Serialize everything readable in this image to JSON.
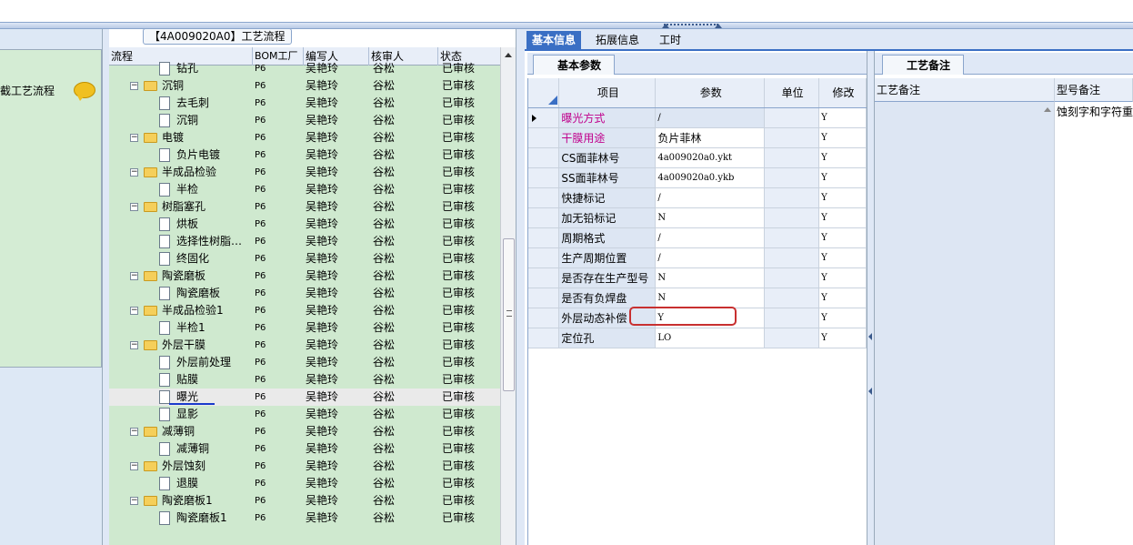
{
  "left_panel": {
    "title": "截工艺流程"
  },
  "tab_chip": {
    "label": "【4A009020A0】工艺流程"
  },
  "tree": {
    "headers": {
      "flow": "流程",
      "bom": "BOM工厂",
      "writer": "编写人",
      "reviewer": "核审人",
      "status": "状态"
    },
    "rows": [
      {
        "label": "钻孔",
        "type": "doc",
        "bom": "P6",
        "writer": "吴艳玲",
        "reviewer": "谷松",
        "status": "已审核"
      },
      {
        "label": "沉铜",
        "type": "folder",
        "bom": "P6",
        "writer": "吴艳玲",
        "reviewer": "谷松",
        "status": "已审核"
      },
      {
        "label": "去毛刺",
        "type": "doc",
        "bom": "P6",
        "writer": "吴艳玲",
        "reviewer": "谷松",
        "status": "已审核"
      },
      {
        "label": "沉铜",
        "type": "doc",
        "bom": "P6",
        "writer": "吴艳玲",
        "reviewer": "谷松",
        "status": "已审核"
      },
      {
        "label": "电镀",
        "type": "folder",
        "bom": "P6",
        "writer": "吴艳玲",
        "reviewer": "谷松",
        "status": "已审核"
      },
      {
        "label": "负片电镀",
        "type": "doc",
        "bom": "P6",
        "writer": "吴艳玲",
        "reviewer": "谷松",
        "status": "已审核"
      },
      {
        "label": "半成品检验",
        "type": "folder",
        "bom": "P6",
        "writer": "吴艳玲",
        "reviewer": "谷松",
        "status": "已审核"
      },
      {
        "label": "半检",
        "type": "doc",
        "bom": "P6",
        "writer": "吴艳玲",
        "reviewer": "谷松",
        "status": "已审核"
      },
      {
        "label": "树脂塞孔",
        "type": "folder",
        "bom": "P6",
        "writer": "吴艳玲",
        "reviewer": "谷松",
        "status": "已审核"
      },
      {
        "label": "烘板",
        "type": "doc",
        "bom": "P6",
        "writer": "吴艳玲",
        "reviewer": "谷松",
        "status": "已审核"
      },
      {
        "label": "选择性树脂…",
        "type": "doc",
        "bom": "P6",
        "writer": "吴艳玲",
        "reviewer": "谷松",
        "status": "已审核"
      },
      {
        "label": "终固化",
        "type": "doc",
        "bom": "P6",
        "writer": "吴艳玲",
        "reviewer": "谷松",
        "status": "已审核"
      },
      {
        "label": "陶瓷磨板",
        "type": "folder",
        "bom": "P6",
        "writer": "吴艳玲",
        "reviewer": "谷松",
        "status": "已审核"
      },
      {
        "label": "陶瓷磨板",
        "type": "doc",
        "bom": "P6",
        "writer": "吴艳玲",
        "reviewer": "谷松",
        "status": "已审核"
      },
      {
        "label": "半成品检验1",
        "type": "folder",
        "bom": "P6",
        "writer": "吴艳玲",
        "reviewer": "谷松",
        "status": "已审核"
      },
      {
        "label": "半检1",
        "type": "doc",
        "bom": "P6",
        "writer": "吴艳玲",
        "reviewer": "谷松",
        "status": "已审核"
      },
      {
        "label": "外层干膜",
        "type": "folder",
        "bom": "P6",
        "writer": "吴艳玲",
        "reviewer": "谷松",
        "status": "已审核"
      },
      {
        "label": "外层前处理",
        "type": "doc",
        "bom": "P6",
        "writer": "吴艳玲",
        "reviewer": "谷松",
        "status": "已审核"
      },
      {
        "label": "贴膜",
        "type": "doc",
        "bom": "P6",
        "writer": "吴艳玲",
        "reviewer": "谷松",
        "status": "已审核"
      },
      {
        "label": "曝光",
        "type": "doc",
        "bom": "P6",
        "writer": "吴艳玲",
        "reviewer": "谷松",
        "status": "已审核",
        "selected": true
      },
      {
        "label": "显影",
        "type": "doc",
        "bom": "P6",
        "writer": "吴艳玲",
        "reviewer": "谷松",
        "status": "已审核"
      },
      {
        "label": "减薄铜",
        "type": "folder",
        "bom": "P6",
        "writer": "吴艳玲",
        "reviewer": "谷松",
        "status": "已审核"
      },
      {
        "label": "减薄铜",
        "type": "doc",
        "bom": "P6",
        "writer": "吴艳玲",
        "reviewer": "谷松",
        "status": "已审核"
      },
      {
        "label": "外层蚀刻",
        "type": "folder",
        "bom": "P6",
        "writer": "吴艳玲",
        "reviewer": "谷松",
        "status": "已审核"
      },
      {
        "label": "退膜",
        "type": "doc",
        "bom": "P6",
        "writer": "吴艳玲",
        "reviewer": "谷松",
        "status": "已审核"
      },
      {
        "label": "陶瓷磨板1",
        "type": "folder",
        "bom": "P6",
        "writer": "吴艳玲",
        "reviewer": "谷松",
        "status": "已审核"
      },
      {
        "label": "陶瓷磨板1",
        "type": "doc",
        "bom": "P6",
        "writer": "吴艳玲",
        "reviewer": "谷松",
        "status": "已审核"
      }
    ]
  },
  "tabs": [
    {
      "label": "基本信息",
      "active": true
    },
    {
      "label": "拓展信息",
      "active": false
    },
    {
      "label": "工时",
      "active": false
    }
  ],
  "subtab": {
    "label": "基本参数"
  },
  "params": {
    "headers": {
      "item": "项目",
      "param": "参数",
      "unit": "单位",
      "modify": "修改"
    },
    "rows": [
      {
        "item": "曝光方式",
        "value": "/",
        "unit": "",
        "modify": "Y",
        "pink": true,
        "current": true
      },
      {
        "item": "干膜用途",
        "value": "负片菲林",
        "unit": "",
        "modify": "Y",
        "pink": true
      },
      {
        "item": "CS面菲林号",
        "value": "4a009020a0.ykt",
        "unit": "",
        "modify": "Y"
      },
      {
        "item": "SS面菲林号",
        "value": "4a009020a0.ykb",
        "unit": "",
        "modify": "Y"
      },
      {
        "item": "快捷标记",
        "value": "/",
        "unit": "",
        "modify": "Y"
      },
      {
        "item": "加无铅标记",
        "value": "N",
        "unit": "",
        "modify": "Y"
      },
      {
        "item": "周期格式",
        "value": "/",
        "unit": "",
        "modify": "Y"
      },
      {
        "item": "生产周期位置",
        "value": "/",
        "unit": "",
        "modify": "Y"
      },
      {
        "item": "是否存在生产型号",
        "value": "N",
        "unit": "",
        "modify": "Y"
      },
      {
        "item": "是否有负焊盘",
        "value": "N",
        "unit": "",
        "modify": "Y"
      },
      {
        "item": "外层动态补偿",
        "value": "Y",
        "unit": "",
        "modify": "Y",
        "highlighted": true
      },
      {
        "item": "定位孔",
        "value": "LO",
        "unit": "",
        "modify": "Y"
      }
    ]
  },
  "notes": {
    "tab_label": "工艺备注",
    "headers": {
      "process_note": "工艺备注",
      "model_note": "型号备注"
    },
    "model_note_value": "蚀刻字和字符重"
  },
  "colors": {
    "tree_bg": "#cfe9cf",
    "tab_active": "#3a6fc4",
    "highlight_box": "#c83030",
    "pink_text": "#c0008c"
  }
}
